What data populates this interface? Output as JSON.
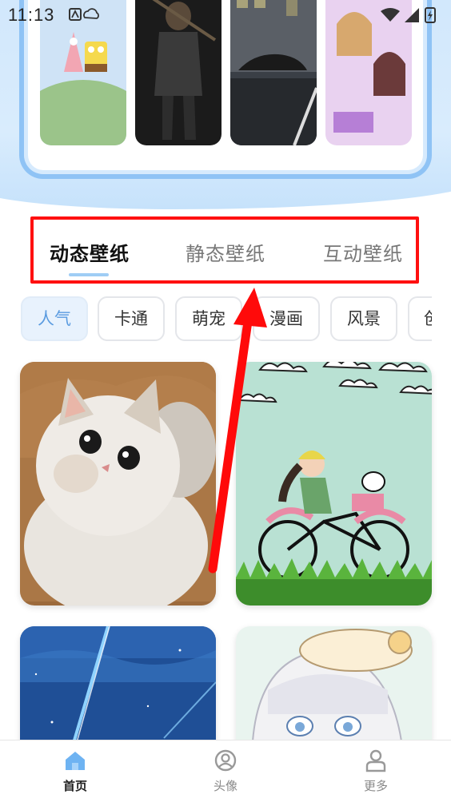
{
  "status_bar": {
    "time": "11:13"
  },
  "tabs": [
    {
      "label": "动态壁纸",
      "active": true
    },
    {
      "label": "静态壁纸",
      "active": false
    },
    {
      "label": "互动壁纸",
      "active": false
    }
  ],
  "categories": [
    {
      "label": "人气",
      "selected": true
    },
    {
      "label": "卡通",
      "selected": false
    },
    {
      "label": "萌宠",
      "selected": false
    },
    {
      "label": "漫画",
      "selected": false
    },
    {
      "label": "风景",
      "selected": false
    },
    {
      "label": "创",
      "selected": false
    }
  ],
  "bottom_nav": [
    {
      "label": "首页",
      "icon": "home-icon",
      "active": true
    },
    {
      "label": "头像",
      "icon": "avatar-icon",
      "active": false
    },
    {
      "label": "更多",
      "icon": "user-icon",
      "active": false
    }
  ],
  "colors": {
    "accent": "#5a9be0",
    "highlight_box": "#ff1010",
    "tab_indicator": "#9fcdf5",
    "banner": "#cfe6fb"
  }
}
